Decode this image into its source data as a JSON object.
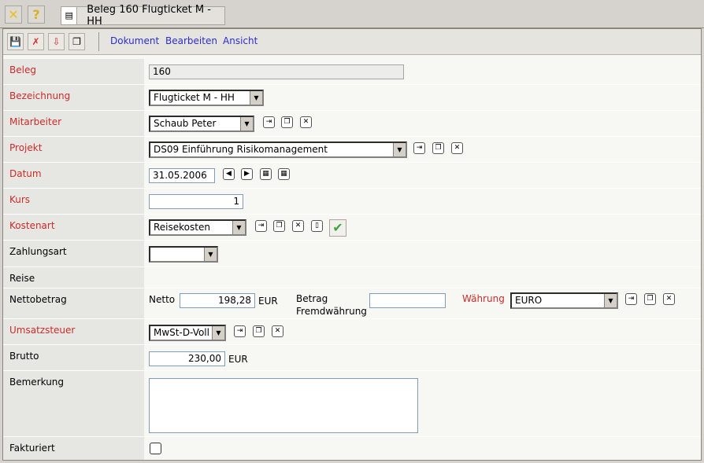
{
  "window": {
    "tab_title": "Beleg 160 Flugticket M - HH"
  },
  "menu": {
    "items": [
      "Dokument",
      "Bearbeiten",
      "Ansicht"
    ]
  },
  "labels": {
    "beleg": "Beleg",
    "bezeichnung": "Bezeichnung",
    "mitarbeiter": "Mitarbeiter",
    "projekt": "Projekt",
    "datum": "Datum",
    "kurs": "Kurs",
    "kostenart": "Kostenart",
    "zahlungsart": "Zahlungsart",
    "reise": "Reise",
    "nettobetrag": "Nettobetrag",
    "umsatzsteuer": "Umsatzsteuer",
    "brutto": "Brutto",
    "bemerkung": "Bemerkung",
    "fakturiert": "Fakturiert",
    "netto": "Netto",
    "eur": "EUR",
    "betrag_fremd_1": "Betrag",
    "betrag_fremd_2": "Fremdwährung",
    "waehrung": "Währung"
  },
  "values": {
    "beleg": "160",
    "bezeichnung": "Flugticket M - HH",
    "mitarbeiter": "Schaub Peter",
    "projekt": "DS09 Einführung Risikomanagement",
    "datum": "31.05.2006",
    "kurs": "1",
    "kostenart": "Reisekosten",
    "zahlungsart": "",
    "netto": "198,28",
    "betrag_fremd": "",
    "waehrung": "EURO",
    "umsatzsteuer": "MwSt-D-Voll",
    "brutto": "230,00",
    "bemerkung": "",
    "fakturiert": false
  },
  "colors": {
    "required_label": "#cc2b2b",
    "menu_link": "#2d2dcc"
  }
}
